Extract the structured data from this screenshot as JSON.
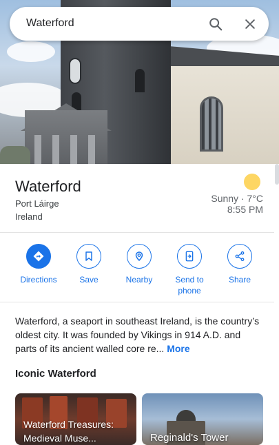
{
  "search": {
    "value": "Waterford"
  },
  "place": {
    "name": "Waterford",
    "subtitle_line1": "Port Láirge",
    "subtitle_line2": "Ireland",
    "weather": "Sunny · 7°C",
    "time": "8:55 PM"
  },
  "actions": [
    {
      "label": "Directions",
      "icon": "directions-icon"
    },
    {
      "label": "Save",
      "icon": "bookmark-icon"
    },
    {
      "label": "Nearby",
      "icon": "nearby-icon"
    },
    {
      "label": "Send to phone",
      "icon": "send-to-phone-icon"
    },
    {
      "label": "Share",
      "icon": "share-icon"
    }
  ],
  "description": {
    "text": "Waterford, a seaport in southeast Ireland, is the country’s oldest city. It was founded by Vikings in 914 A.D. and parts of its ancient walled core re...",
    "more_label": "More"
  },
  "section": {
    "title": "Iconic Waterford"
  },
  "cards": [
    {
      "label_line1": "Waterford Treasures:",
      "label_line2": "Medieval Muse..."
    },
    {
      "label_line1": "Reginald's Tower"
    }
  ],
  "colors": {
    "accent": "#1a73e8",
    "sun": "#fdd663"
  }
}
